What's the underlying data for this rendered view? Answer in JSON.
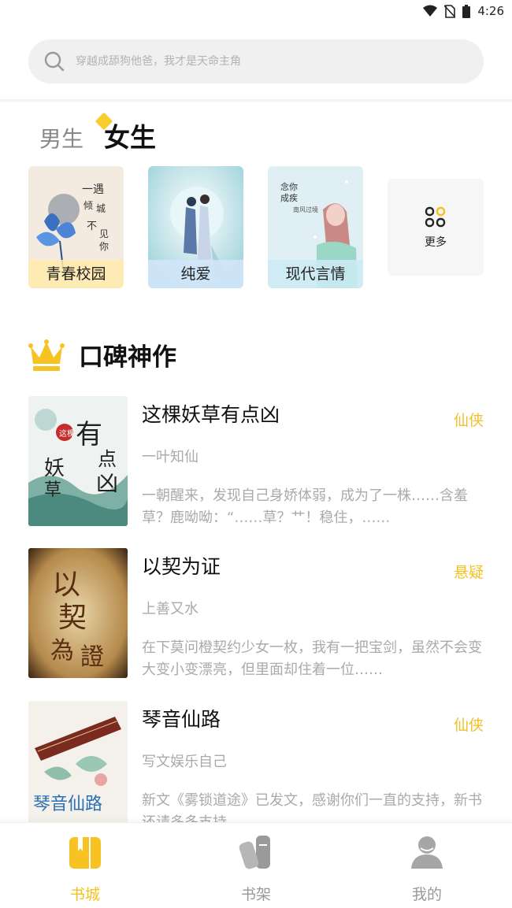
{
  "status_bar": {
    "time": "4:26"
  },
  "search": {
    "placeholder": "穿越成舔狗他爸，我才是天命主角"
  },
  "gender_tabs": {
    "male": "男生",
    "female": "女生"
  },
  "categories": [
    {
      "label": "青春校园"
    },
    {
      "label": "纯爱"
    },
    {
      "label": "现代言情"
    }
  ],
  "more": {
    "label": "更多"
  },
  "section": {
    "title": "口碑神作"
  },
  "books": [
    {
      "title": "这棵妖草有点凶",
      "genre": "仙侠",
      "author": "一叶知仙",
      "desc": "一朝醒来，发现自己身娇体弱，成为了一株……含羞草？鹿呦呦：“……草？艹！稳住，……"
    },
    {
      "title": "以契为证",
      "genre": "悬疑",
      "author": "上善又水",
      "desc": "在下莫问橙契约少女一枚，我有一把宝剑，虽然不会变大变小变漂亮，但里面却住着一位……"
    },
    {
      "title": "琴音仙路",
      "genre": "仙侠",
      "author": "写文娱乐自己",
      "desc": "新文《雾锁道途》已发文，感谢你们一直的支持，新书还请多多支持……"
    }
  ],
  "bottom_nav": [
    {
      "label": "书城",
      "icon": "book-city-icon",
      "active": true
    },
    {
      "label": "书架",
      "icon": "bookshelf-icon",
      "active": false
    },
    {
      "label": "我的",
      "icon": "profile-icon",
      "active": false
    }
  ],
  "colors": {
    "accent": "#f5c21d",
    "muted": "#aaaaaa"
  }
}
